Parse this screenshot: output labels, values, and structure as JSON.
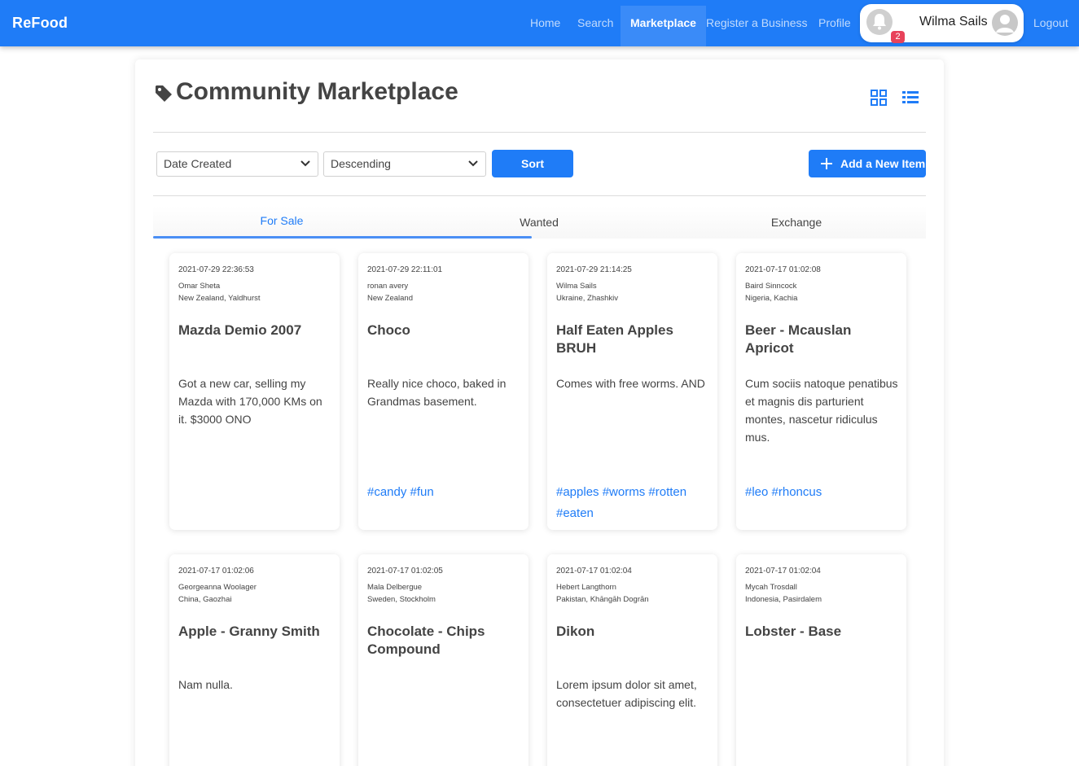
{
  "nav": {
    "brand": "ReFood",
    "links": [
      "Home",
      "Search",
      "Marketplace",
      "Register a Business",
      "Profile"
    ],
    "active": "Marketplace",
    "notification_count": "2",
    "user_name": "Wilma Sails",
    "logout": "Logout"
  },
  "page": {
    "title": "Community Marketplace",
    "sort_field": "Date Created",
    "sort_order": "Descending",
    "sort_button": "Sort",
    "add_button": "Add a New Item",
    "tabs": [
      "For Sale",
      "Wanted",
      "Exchange"
    ],
    "active_tab": "For Sale"
  },
  "colors": {
    "primary": "#1f7cf7",
    "badge": "#e8425a"
  },
  "listings": [
    {
      "date": "2021-07-29 22:36:53",
      "person": "Omar Sheta",
      "location": "New Zealand, Yaldhurst",
      "title": "Mazda Demio 2007",
      "description": "Got a new car, selling my Mazda with 170,000 KMs on it. $3000 ONO",
      "tags": ""
    },
    {
      "date": "2021-07-29 22:11:01",
      "person": "ronan avery",
      "location": "New Zealand",
      "title": "Choco",
      "description": "Really nice choco, baked in Grandmas basement.",
      "tags": "#candy #fun"
    },
    {
      "date": "2021-07-29 21:14:25",
      "person": "Wilma Sails",
      "location": "Ukraine, Zhashkiv",
      "title": "Half Eaten Apples BRUH",
      "description": "Comes with free worms. AND",
      "tags": "#apples #worms #rotten #eaten"
    },
    {
      "date": "2021-07-17 01:02:08",
      "person": "Baird Sinncock",
      "location": "Nigeria, Kachia",
      "title": "Beer - Mcauslan Apricot",
      "description": "Cum sociis natoque penatibus et magnis dis parturient montes, nascetur ridiculus mus.",
      "tags": "#leo #rhoncus"
    },
    {
      "date": "2021-07-17 01:02:06",
      "person": "Georgeanna Woolager",
      "location": "China, Gaozhai",
      "title": "Apple - Granny Smith",
      "description": "Nam nulla.",
      "tags": ""
    },
    {
      "date": "2021-07-17 01:02:05",
      "person": "Mala Delbergue",
      "location": "Sweden, Stockholm",
      "title": "Chocolate - Chips Compound",
      "description": "",
      "tags": ""
    },
    {
      "date": "2021-07-17 01:02:04",
      "person": "Hebert Langthorn",
      "location": "Pakistan, Khāngāh Dogrān",
      "title": "Dikon",
      "description": "Lorem ipsum dolor sit amet, consectetuer adipiscing elit.",
      "tags": ""
    },
    {
      "date": "2021-07-17 01:02:04",
      "person": "Mycah Trosdall",
      "location": "Indonesia, Pasirdalem",
      "title": "Lobster - Base",
      "description": "",
      "tags": ""
    }
  ]
}
